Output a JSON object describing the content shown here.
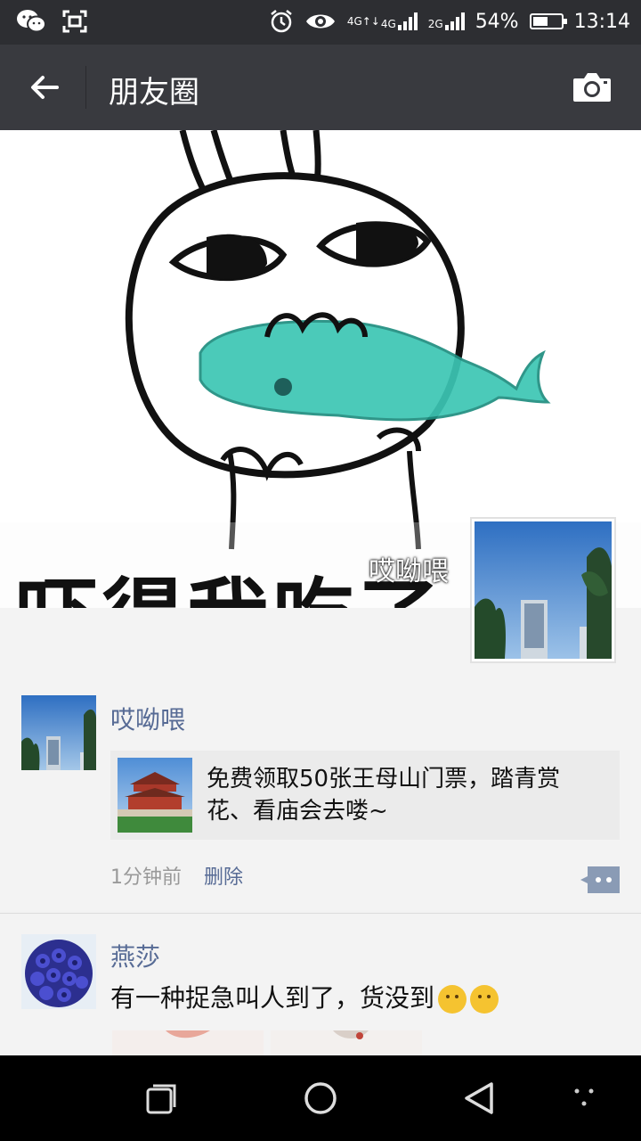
{
  "status_bar": {
    "time": "13:14",
    "battery": "54%",
    "battery_level": 0.54,
    "net_label_1": "4G",
    "net_label_2": "2G",
    "icons": [
      "wechat-icon",
      "screenshot-icon",
      "alarm-icon",
      "eye-icon",
      "data-arrows-icon",
      "signal-icon",
      "battery-icon"
    ]
  },
  "header": {
    "title": "朋友圈",
    "back_icon": "back-arrow-icon",
    "camera_icon": "camera-icon"
  },
  "cover": {
    "text": "吓得我吃了一",
    "username": "哎呦喂"
  },
  "posts": [
    {
      "name": "哎呦喂",
      "link_text": "免费领取50张王母山门票，踏青赏花、看庙会去喽~",
      "time": "1分钟前",
      "delete": "删除"
    },
    {
      "name": "燕莎",
      "text": "有一种捉急叫人到了，货没到"
    }
  ],
  "colors": {
    "header_bg": "#393a3f",
    "status_bg": "#2d2e32",
    "link_blue": "#576b95",
    "feed_bg": "#f3f3f3"
  }
}
